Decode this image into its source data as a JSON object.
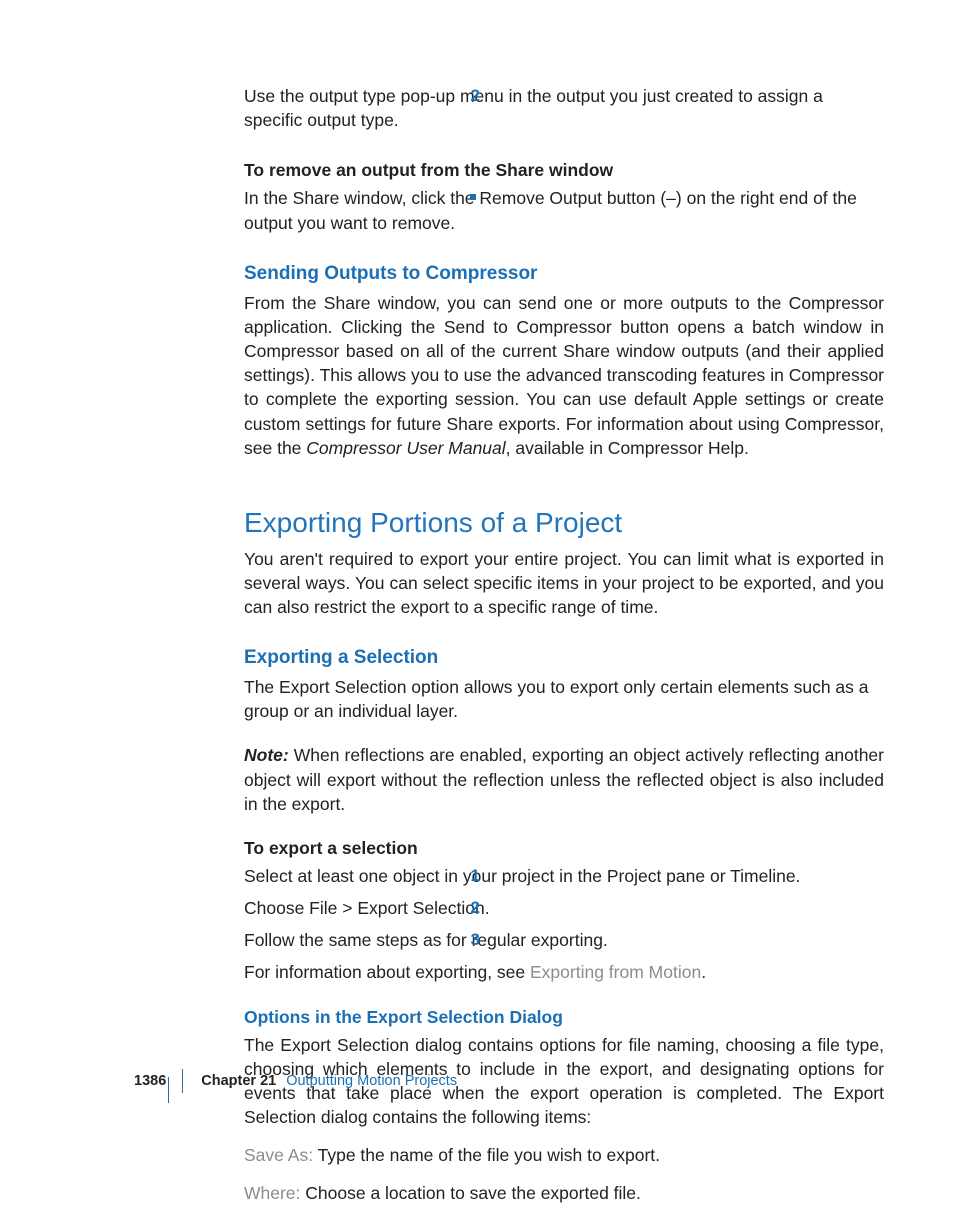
{
  "step2": {
    "num": "2",
    "text": "Use the output type pop-up menu in the output you just created to assign a specific output type."
  },
  "subhead1": "To remove an output from the Share window",
  "bullet1": "In the Share window, click the Remove Output button (–) on the right end of the output you want to remove.",
  "h3a": "Sending Outputs to Compressor",
  "para_a1": "From the Share window, you can send one or more outputs to the Compressor application. Clicking the Send to Compressor button opens a batch window in Compressor based on all of the current Share window outputs (and their applied settings). This allows you to use the advanced transcoding features in Compressor to complete the exporting session. You can use default Apple settings or create custom settings for future Share exports. For information about using Compressor, see the ",
  "para_a1_em": "Compressor User Manual",
  "para_a1_tail": ", available in Compressor Help.",
  "h2a": "Exporting Portions of a Project",
  "para_b1": "You aren't required to export your entire project. You can limit what is exported in several ways. You can select specific items in your project to be exported, and you can also restrict the export to a specific range of time.",
  "h3b": "Exporting a Selection",
  "para_c1": "The Export Selection option allows you to export only certain elements such as a group or an individual layer.",
  "note_label": "Note:",
  "note_body": "  When reflections are enabled, exporting an object actively reflecting another object will export without the reflection unless the reflected object is also included in the export.",
  "subhead2": "To export a selection",
  "steps": {
    "s1n": "1",
    "s1t": "Select at least one object in your project in the Project pane or Timeline.",
    "s2n": "2",
    "s2t": "Choose File > Export Selection.",
    "s3n": "3",
    "s3t": "Follow the same steps as for regular exporting.",
    "s3_more_a": "For information about exporting, see ",
    "s3_more_link": "Exporting from Motion",
    "s3_more_b": "."
  },
  "h4a": "Options in the Export Selection Dialog",
  "para_d1": "The Export Selection dialog contains options for file naming, choosing a file type, choosing which elements to include in the export, and designating options for events that take place when the export operation is completed. The Export Selection dialog contains the following items:",
  "opt1_label": "Save As:",
  "opt1_body": "  Type the name of the file you wish to export.",
  "opt2_label": "Where:",
  "opt2_body": "  Choose a location to save the exported file.",
  "footer": {
    "page": "1386",
    "chapter": "Chapter 21",
    "title": "Outputting Motion Projects"
  }
}
